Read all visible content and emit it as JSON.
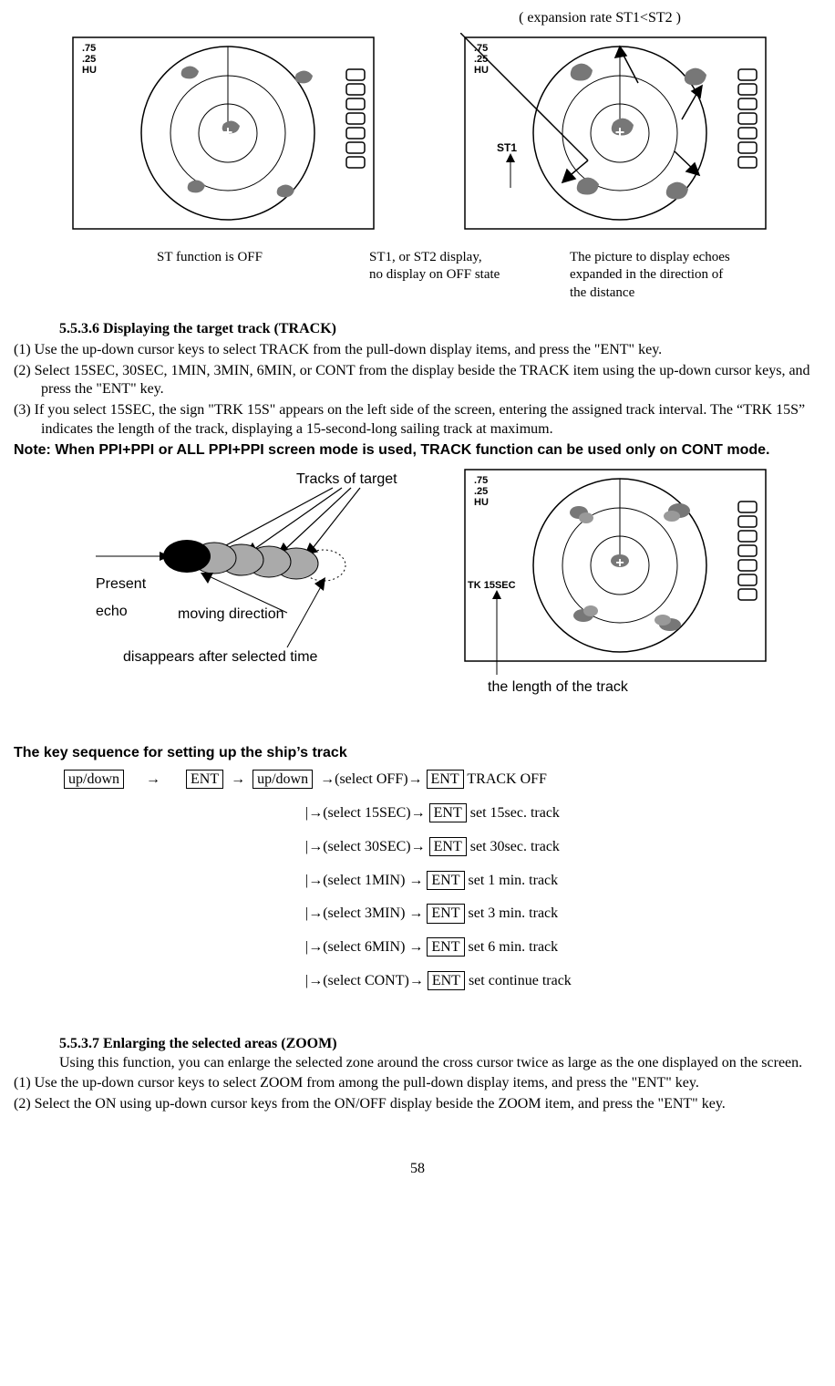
{
  "header_note": "( expansion rate ST1<ST2 )",
  "radar1": {
    "line1": ".75",
    "line2": ".25",
    "line3": "HU"
  },
  "radar2": {
    "line1": ".75",
    "line2": ".25",
    "line3": "HU",
    "side": "ST1"
  },
  "radar3": {
    "line1": ".75",
    "line2": ".25",
    "line3": "HU",
    "side": "TK 15SEC"
  },
  "caption1": "ST function is OFF",
  "caption2a": "ST1, or ST2 display,",
  "caption2b": "no display on OFF state",
  "caption3a": "The picture to display echoes",
  "caption3b": "expanded in the direction of",
  "caption3c": "the distance",
  "sec1_heading": "5.5.3.6 Displaying the target track (TRACK)",
  "sec1_p1": "(1)  Use the up-down cursor keys to select TRACK from the pull-down display items, and press the \"ENT\" key.",
  "sec1_p2": "(2)   Select 15SEC, 30SEC, 1MIN, 3MIN, 6MIN, or CONT from the display beside the TRACK item using the up-down cursor keys, and press the \"ENT\" key.",
  "sec1_p3": "(3)   If you select 15SEC, the sign \"TRK 15S\" appears on the left side of the screen, entering the assigned track interval.  The “TRK 15S” indicates the length of the track, displaying a 15-second-long sailing track at maximum.",
  "note": "Note: When PPI+PPI or ALL PPI+PPI screen mode is used, TRACK function can be used only on CONT mode.",
  "track_label": "Tracks of target",
  "present_label": "Present",
  "echo_label": "echo",
  "moving_label": "moving direction",
  "disappear_label": "disappears after selected time",
  "track_len_label": "the length of the track",
  "seq_heading": "The key sequence for setting up the ship’s track",
  "keys": {
    "updown": "up/down",
    "ent": "ENT"
  },
  "arrow": "→",
  "seq": {
    "off_sel": "(select OFF)",
    "off_res": " TRACK OFF",
    "s15_sel": "(select 15SEC)",
    "s15_res": "  set 15sec. track",
    "s30_sel": "(select 30SEC)",
    "s30_res": "  set 30sec. track",
    "m1_sel": "(select 1MIN)  ",
    "m1_res": "  set 1 min. track",
    "m3_sel": "(select 3MIN)  ",
    "m3_res": "  set 3 min. track",
    "m6_sel": "(select 6MIN)  ",
    "m6_res": "  set 6 min. track",
    "cont_sel": "(select CONT)",
    "cont_res": "  set continue track"
  },
  "sec2_heading": "5.5.3.7 Enlarging the selected areas (ZOOM)",
  "sec2_intro": "Using this function, you can enlarge the selected zone around the cross cursor twice as large as the one displayed on the screen.",
  "sec2_p1": "(1)    Use the up-down cursor keys to select ZOOM from among the pull-down display items, and press the \"ENT\" key.",
  "sec2_p2": "(2)    Select the ON using up-down cursor keys from the ON/OFF display beside the ZOOM item, and press the \"ENT\" key.",
  "page": "58"
}
